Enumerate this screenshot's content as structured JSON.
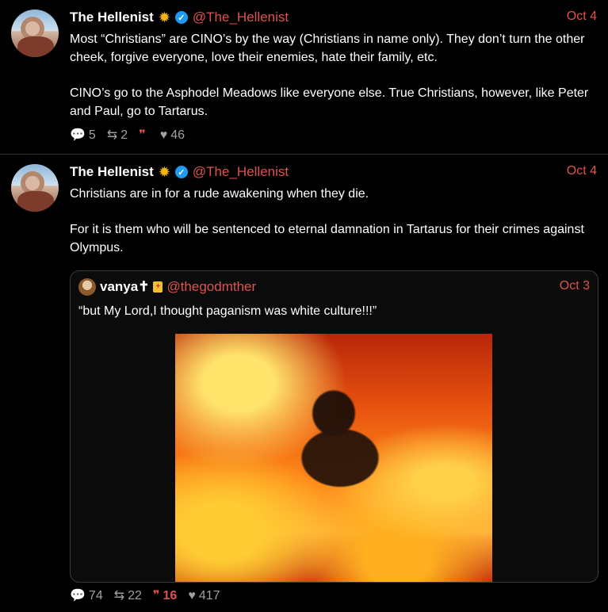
{
  "tweets": [
    {
      "author": {
        "name": "The Hellenist",
        "badge_icon": "sun-icon",
        "handle": "@The_Hellenist"
      },
      "date": "Oct 4",
      "paragraphs": [
        "Most “Christians” are CINO’s by the way (Christians in name only). They don’t turn the other cheek, forgive everyone, love their enemies, hate their family, etc.",
        "CINO’s go to the Asphodel Meadows like everyone else. True Christians, however, like Peter and Paul, go to Tartarus."
      ],
      "stats": {
        "replies": "5",
        "retweets": "2",
        "quotes": "",
        "likes": "46"
      }
    },
    {
      "author": {
        "name": "The Hellenist",
        "badge_icon": "sun-icon",
        "handle": "@The_Hellenist"
      },
      "date": "Oct 4",
      "paragraphs": [
        "Christians are in for a rude awakening when they die.",
        "For it is them who will be sentenced to eternal damnation in Tartarus for their crimes against Olympus."
      ],
      "quoted": {
        "name": "vanya✝",
        "handle": "@thegodmther",
        "date": "Oct 3",
        "text": "“but My Lord,I thought paganism was white culture!!!”"
      },
      "stats": {
        "replies": "74",
        "retweets": "22",
        "quotes": "16",
        "likes": "417"
      }
    }
  ],
  "colors": {
    "accent": "#e0524c",
    "verified": "#1d9bf0",
    "muted": "#a0a0a0",
    "background": "#000000"
  }
}
